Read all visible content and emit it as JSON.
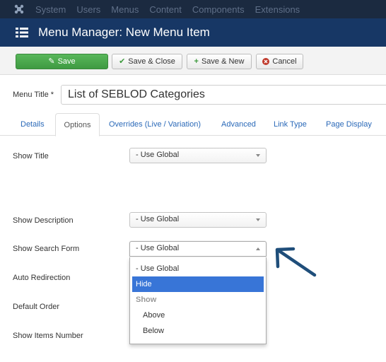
{
  "topnav": {
    "items": [
      "System",
      "Users",
      "Menus",
      "Content",
      "Components",
      "Extensions"
    ]
  },
  "header": {
    "title": "Menu Manager: New Menu Item"
  },
  "toolbar": {
    "save_label": "Save",
    "save_close_label": "Save & Close",
    "save_new_label": "Save & New",
    "cancel_label": "Cancel"
  },
  "menu_title": {
    "label": "Menu Title *",
    "value": "List of SEBLOD Categories"
  },
  "tabs": [
    {
      "label": "Details"
    },
    {
      "label": "Options",
      "active": true
    },
    {
      "label": "Overrides (Live / Variation)"
    },
    {
      "label": "Advanced"
    },
    {
      "label": "Link Type"
    },
    {
      "label": "Page Display"
    }
  ],
  "fields": {
    "show_title": {
      "label": "Show Title",
      "value": "- Use Global"
    },
    "show_description": {
      "label": "Show Description",
      "value": "- Use Global"
    },
    "show_search_form": {
      "label": "Show Search Form",
      "value": "- Use Global"
    },
    "auto_redirection": {
      "label": "Auto Redirection"
    },
    "default_order": {
      "label": "Default Order"
    },
    "show_items_number": {
      "label": "Show Items Number"
    }
  },
  "dropdown": {
    "options": [
      {
        "label": "- Use Global"
      },
      {
        "label": "Hide",
        "highlighted": true
      },
      {
        "label": "Show",
        "group": true
      },
      {
        "label": "Above"
      },
      {
        "label": "Below"
      }
    ]
  },
  "colors": {
    "topnav_bg": "#1b2a40",
    "titlebar_bg": "#173765",
    "save_green": "#46a546",
    "link_blue": "#2a69b8",
    "highlight_blue": "#3875d7",
    "arrow_color": "#1f4e7a"
  }
}
